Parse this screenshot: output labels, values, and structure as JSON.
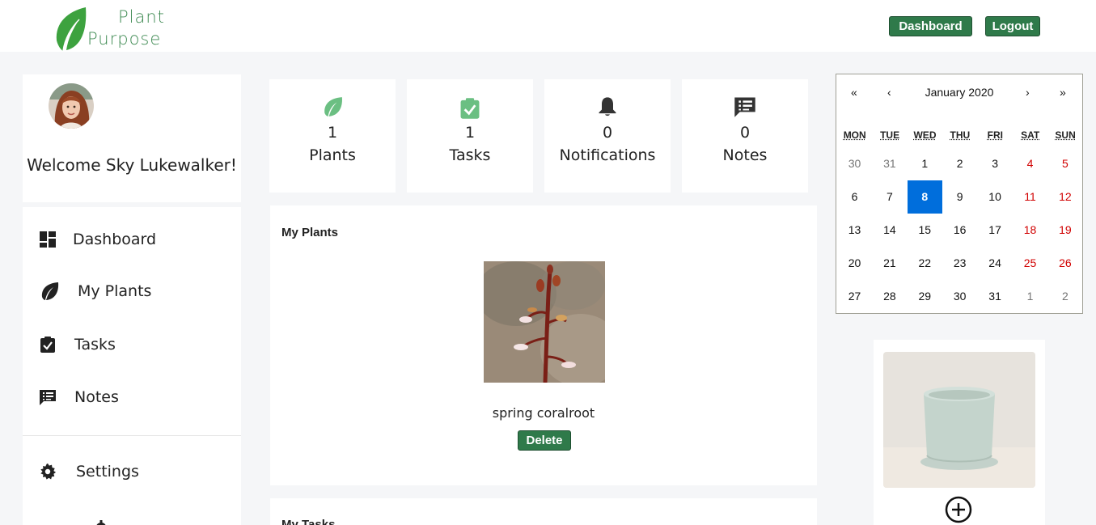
{
  "header": {
    "logo_line1": "Plant",
    "logo_line2": "Purpose",
    "nav_dashboard": "Dashboard",
    "nav_logout": "Logout",
    "brand_color": "#3e8a52",
    "button_color": "#2f7a4a"
  },
  "profile": {
    "welcome": "Welcome Sky Lukewalker!"
  },
  "sidebar": {
    "items": [
      {
        "label": "Dashboard",
        "icon": "dashboard-icon"
      },
      {
        "label": "My Plants",
        "icon": "leaf-icon"
      },
      {
        "label": "Tasks",
        "icon": "clipboard-check-icon"
      },
      {
        "label": "Notes",
        "icon": "note-icon"
      },
      {
        "label": "Settings",
        "icon": "gear-icon"
      }
    ]
  },
  "stats": [
    {
      "value": "1",
      "label": "Plants",
      "icon": "leaf-icon",
      "color": "#6bbf82"
    },
    {
      "value": "1",
      "label": "Tasks",
      "icon": "clipboard-check-icon",
      "color": "#6bbf82"
    },
    {
      "value": "0",
      "label": "Notifications",
      "icon": "bell-icon",
      "color": "#333333"
    },
    {
      "value": "0",
      "label": "Notes",
      "icon": "note-icon",
      "color": "#333333"
    }
  ],
  "my_plants": {
    "title": "My Plants",
    "plants": [
      {
        "name": "spring coralroot",
        "delete_label": "Delete"
      }
    ]
  },
  "my_tasks": {
    "title": "My Tasks"
  },
  "calendar": {
    "prev_year": "«",
    "prev_month": "‹",
    "next_month": "›",
    "next_year": "»",
    "title": "January 2020",
    "weekdays": [
      "MON",
      "TUE",
      "WED",
      "THU",
      "FRI",
      "SAT",
      "SUN"
    ],
    "weeks": [
      [
        "30",
        "31",
        "1",
        "2",
        "3",
        "4",
        "5"
      ],
      [
        "6",
        "7",
        "8",
        "9",
        "10",
        "11",
        "12"
      ],
      [
        "13",
        "14",
        "15",
        "16",
        "17",
        "18",
        "19"
      ],
      [
        "20",
        "21",
        "22",
        "23",
        "24",
        "25",
        "26"
      ],
      [
        "27",
        "28",
        "29",
        "30",
        "31",
        "1",
        "2"
      ]
    ],
    "selected": "8",
    "selected_color": "#006edc"
  }
}
